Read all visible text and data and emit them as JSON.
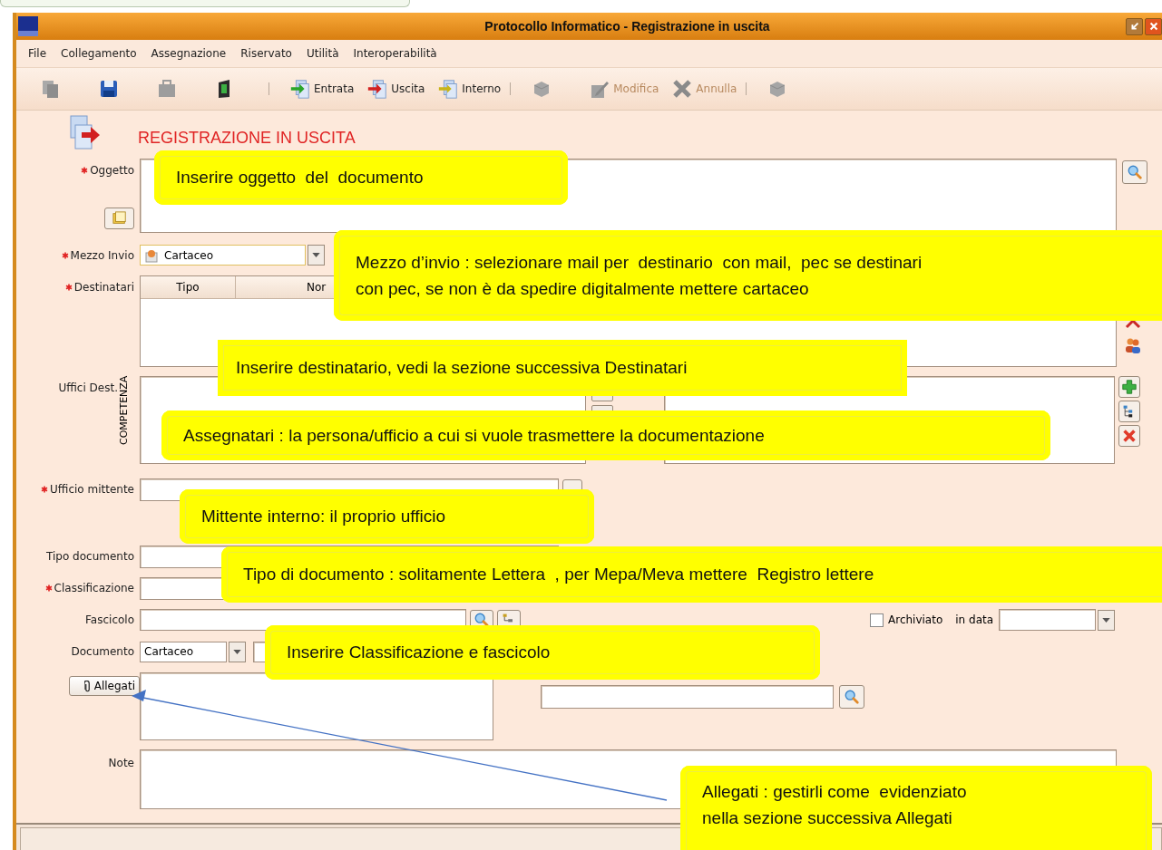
{
  "window": {
    "title": "Protocollo Informatico - Registrazione in uscita"
  },
  "menu": [
    {
      "label": "File"
    },
    {
      "label": "Collegamento"
    },
    {
      "label": "Assegnazione"
    },
    {
      "label": "Riservato"
    },
    {
      "label": "Utilità"
    },
    {
      "label": "Interoperabilità"
    }
  ],
  "toolbar": [
    {
      "kind": "icon",
      "disabled": true
    },
    {
      "kind": "icon",
      "disabled": false
    },
    {
      "kind": "icon",
      "disabled": true
    },
    {
      "kind": "icon",
      "disabled": false
    },
    {
      "kind": "separator"
    },
    {
      "kind": "labeled",
      "label": "Entrata",
      "disabled": false
    },
    {
      "kind": "labeled",
      "label": "Uscita",
      "disabled": false
    },
    {
      "kind": "labeled",
      "label": "Interno",
      "disabled": false
    },
    {
      "kind": "separator"
    },
    {
      "kind": "icon",
      "disabled": true
    },
    {
      "kind": "labeled",
      "label": "Modifica",
      "disabled": true
    },
    {
      "kind": "labeled",
      "label": "Annulla",
      "disabled": true
    },
    {
      "kind": "separator"
    },
    {
      "kind": "icon",
      "disabled": true
    }
  ],
  "form": {
    "heading": "REGISTRAZIONE IN USCITA",
    "oggetto": {
      "label": "Oggetto",
      "required": true
    },
    "mezzo_invio": {
      "label": "Mezzo Invio",
      "required": true,
      "value": "Cartaceo"
    },
    "destinatari": {
      "label": "Destinatari",
      "required": true,
      "columns": [
        "Tipo",
        "Nor"
      ]
    },
    "uffici_dest": {
      "label": "Uffici Dest.",
      "panel_label": "COMPETENZA"
    },
    "ufficio_mittente": {
      "label": "Ufficio mittente",
      "required": true
    },
    "tipo_documento": {
      "label": "Tipo documento",
      "required": false
    },
    "classificazione": {
      "label": "Classificazione",
      "required": true
    },
    "fascicolo": {
      "label": "Fascicolo",
      "required": false
    },
    "archiviato": {
      "label": "Archiviato",
      "checked": false
    },
    "in_data": {
      "label": "in data"
    },
    "documento": {
      "label": "Documento",
      "value": "Cartaceo"
    },
    "allegati_button": "Allegati",
    "note": {
      "label": "Note"
    }
  },
  "callouts": [
    {
      "lines": [
        "Inserire oggetto  del  documento"
      ]
    },
    {
      "lines": [
        "Mezzo d’invio : selezionare mail per  destinario  con mail,  pec se destinari",
        "con pec, se non è da spedire digitalmente mettere cartaceo"
      ]
    },
    {
      "lines": [
        "Inserire destinatario, vedi la sezione successiva Destinatari"
      ]
    },
    {
      "lines": [
        "Assegnatari : la persona/ufficio a cui si vuole trasmettere la documentazione"
      ]
    },
    {
      "lines": [
        "Mittente interno: il proprio ufficio"
      ]
    },
    {
      "lines": [
        "Tipo di documento : solitamente Lettera  , per Mepa/Meva mettere  Registro lettere"
      ]
    },
    {
      "lines": [
        "Inserire Classificazione e fascicolo"
      ]
    },
    {
      "lines": [
        "Allegati : gestirli come  evidenziato",
        "nella sezione successiva Allegati"
      ]
    }
  ]
}
